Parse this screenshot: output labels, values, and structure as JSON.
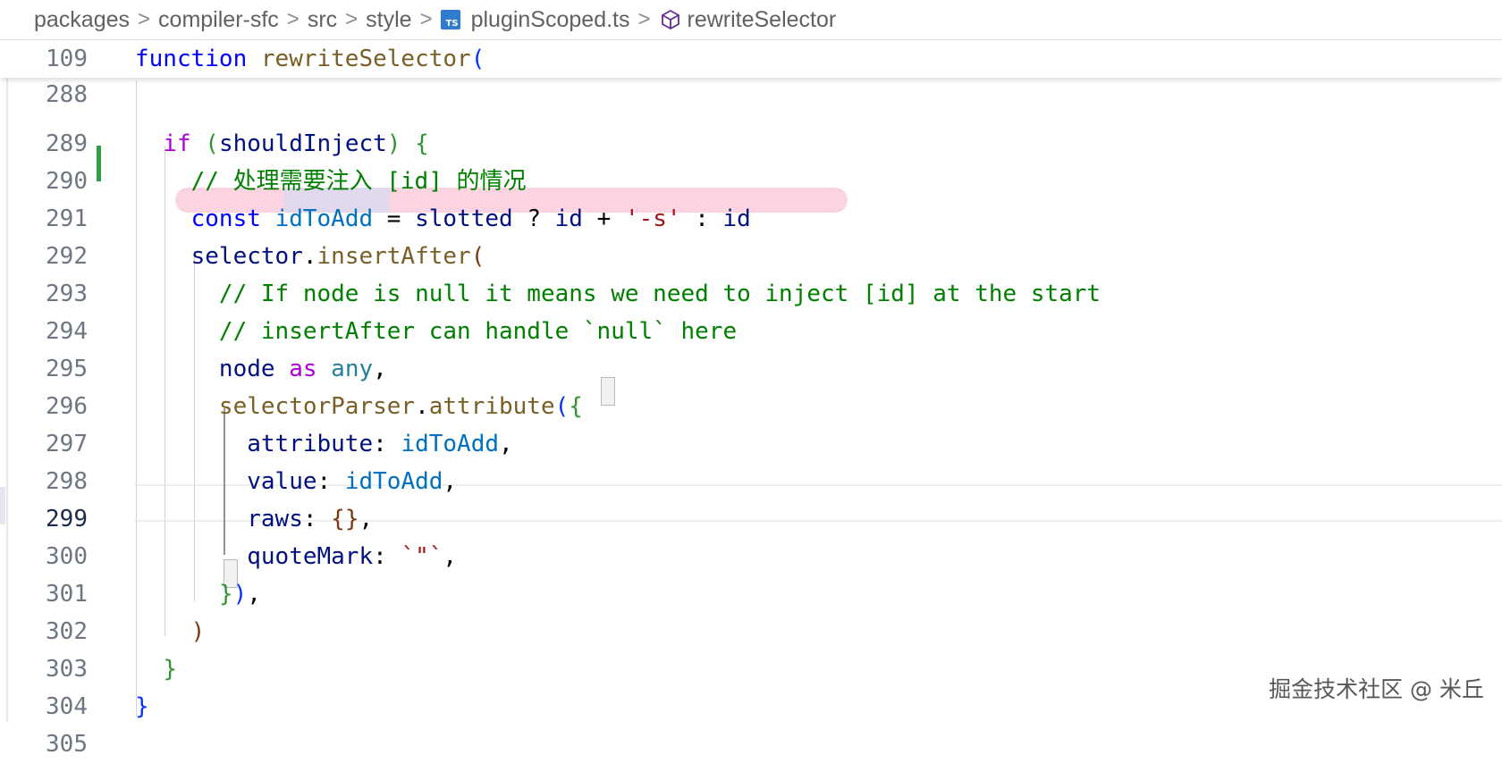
{
  "breadcrumb": {
    "items": [
      "packages",
      "compiler-sfc",
      "src",
      "style",
      "pluginScoped.ts",
      "rewriteSelector"
    ],
    "separator": ">",
    "file_icon": "ts-file-icon",
    "file_icon_text": "TS",
    "symbol_icon": "method-cube-icon"
  },
  "sticky": {
    "line_number": "109",
    "keyword": "function",
    "name": "rewriteSelector",
    "paren": "("
  },
  "lines": {
    "l288": {
      "num": "288"
    },
    "l289": {
      "num": "289",
      "if": "if",
      "p_open": "(",
      "cond": "shouldInject",
      "p_close": ")",
      "brace": "{"
    },
    "l290": {
      "num": "290",
      "comment": "// 处理需要注入 [id] 的情况"
    },
    "l291": {
      "num": "291",
      "kw": "const",
      "name": "idToAdd",
      "eq": " = ",
      "slotted": "slotted",
      "q": " ? ",
      "id1": "id",
      "plus": " + ",
      "str": "'-s'",
      "colon": " : ",
      "id2": "id"
    },
    "l292": {
      "num": "292",
      "obj": "selector",
      "dot": ".",
      "method": "insertAfter",
      "paren": "("
    },
    "l293": {
      "num": "293",
      "comment": "// If node is null it means we need to inject [id] at the start"
    },
    "l294": {
      "num": "294",
      "comment": "// insertAfter can handle `null` here"
    },
    "l295": {
      "num": "295",
      "node": "node",
      "as": "as",
      "any": "any",
      "comma": ","
    },
    "l296": {
      "num": "296",
      "obj": "selectorParser",
      "dot": ".",
      "method": "attribute",
      "paren": "(",
      "brace": "{"
    },
    "l297": {
      "num": "297",
      "key": "attribute",
      "colon": ": ",
      "val": "idToAdd",
      "comma": ","
    },
    "l298": {
      "num": "298",
      "key": "value",
      "colon": ": ",
      "val": "idToAdd",
      "comma": ","
    },
    "l299": {
      "num": "299",
      "key": "raws",
      "colon": ": ",
      "val": "{}",
      "comma": ","
    },
    "l300": {
      "num": "300",
      "key": "quoteMark",
      "colon": ": ",
      "val": "`\"`",
      "comma": ","
    },
    "l301": {
      "num": "301",
      "brace": "}",
      "paren": ")",
      "comma": ","
    },
    "l302": {
      "num": "302",
      "paren": ")"
    },
    "l303": {
      "num": "303",
      "brace": "}"
    },
    "l304": {
      "num": "304",
      "brace": "}"
    },
    "l305": {
      "num": "305"
    }
  },
  "active_line": "299",
  "watermark": "掘金技术社区 @ 米丘"
}
